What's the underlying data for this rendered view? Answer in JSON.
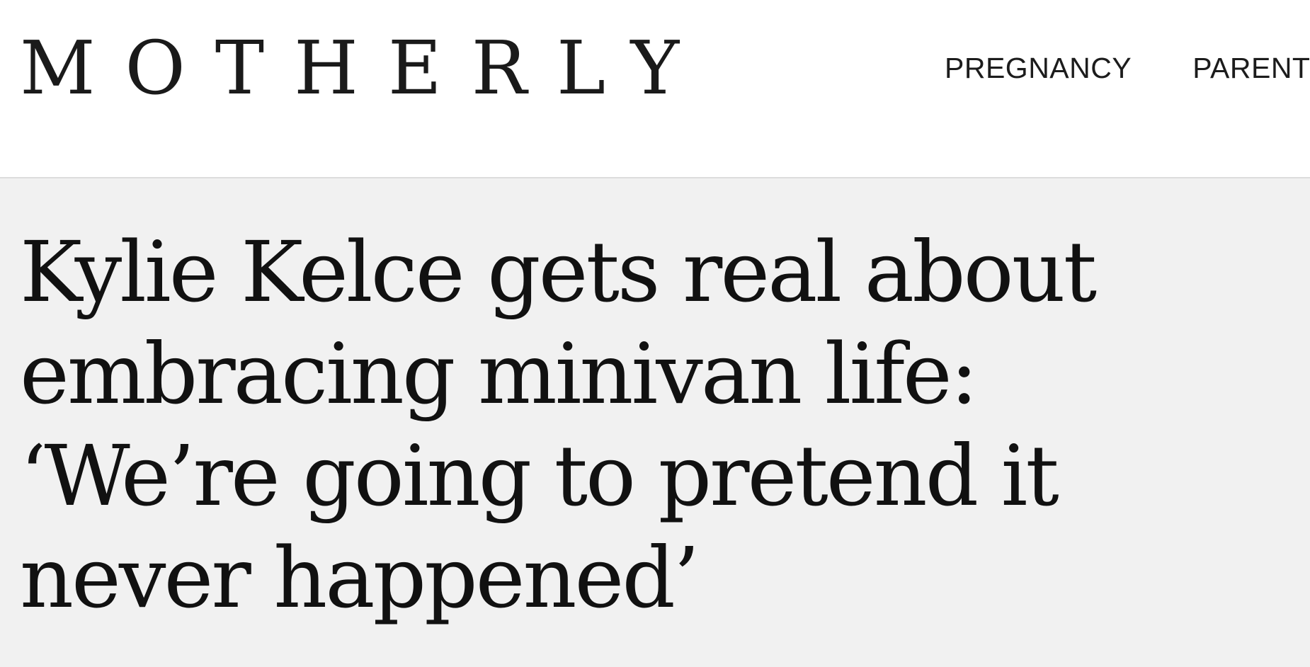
{
  "site": {
    "logo_text": "MOTHERLY"
  },
  "nav": {
    "items": [
      {
        "label": "PREGNANCY"
      },
      {
        "label": "PARENT"
      }
    ]
  },
  "article": {
    "headline": "Kylie Kelce gets real about embracing minivan life: ‘We’re going to pretend it never happened’"
  }
}
